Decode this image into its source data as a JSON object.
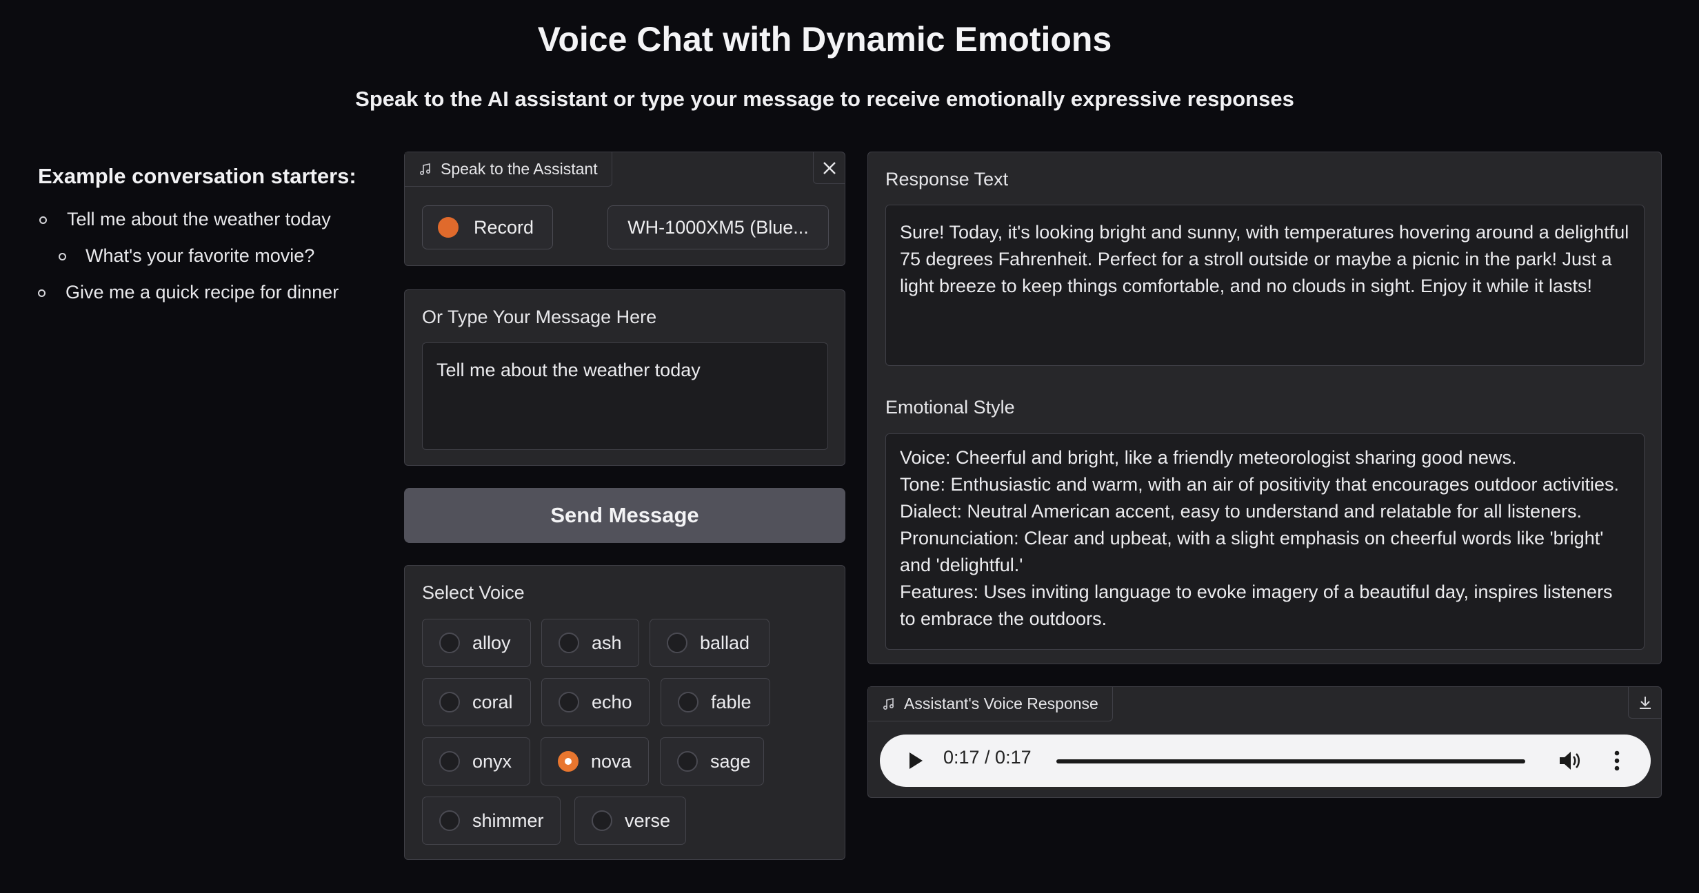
{
  "header": {
    "title": "Voice Chat with Dynamic Emotions",
    "subtitle": "Speak to the AI assistant or type your message to receive emotionally expressive responses"
  },
  "sidebar": {
    "heading": "Example conversation starters:",
    "items": [
      "Tell me about the weather today",
      "What's your favorite movie?",
      "Give me a quick recipe for dinner"
    ]
  },
  "audio_input": {
    "label": "Speak to the Assistant",
    "record_label": "Record",
    "device": "WH-1000XM5 (Blue..."
  },
  "text_input": {
    "label": "Or Type Your Message Here",
    "value": "Tell me about the weather today"
  },
  "send_button": "Send Message",
  "voice_select": {
    "label": "Select Voice",
    "options": [
      "alloy",
      "ash",
      "ballad",
      "coral",
      "echo",
      "fable",
      "onyx",
      "nova",
      "sage",
      "shimmer",
      "verse"
    ],
    "selected": "nova"
  },
  "response": {
    "label": "Response Text",
    "text": "Sure! Today, it's looking bright and sunny, with temperatures hovering around a delightful 75 degrees Fahrenheit. Perfect for a stroll outside or maybe a picnic in the park! Just a light breeze to keep things comfortable, and no clouds in sight. Enjoy it while it lasts!"
  },
  "emotional_style": {
    "label": "Emotional Style",
    "lines": [
      "Voice: Cheerful and bright, like a friendly meteorologist sharing good news.",
      "Tone: Enthusiastic and warm, with an air of positivity that encourages outdoor activities.",
      "Dialect: Neutral American accent, easy to understand and relatable for all listeners.",
      "Pronunciation: Clear and upbeat, with a slight emphasis on cheerful words like 'bright' and 'delightful.'",
      "Features: Uses inviting language to evoke imagery of a beautiful day, inspires listeners to embrace the outdoors."
    ]
  },
  "voice_response": {
    "label": "Assistant's Voice Response",
    "time": "0:17 / 0:17",
    "progress": 1.0
  },
  "colors": {
    "accent": "#e8762f",
    "background": "#0b0b0f",
    "panel": "#27272a",
    "send_button": "#52525b"
  }
}
